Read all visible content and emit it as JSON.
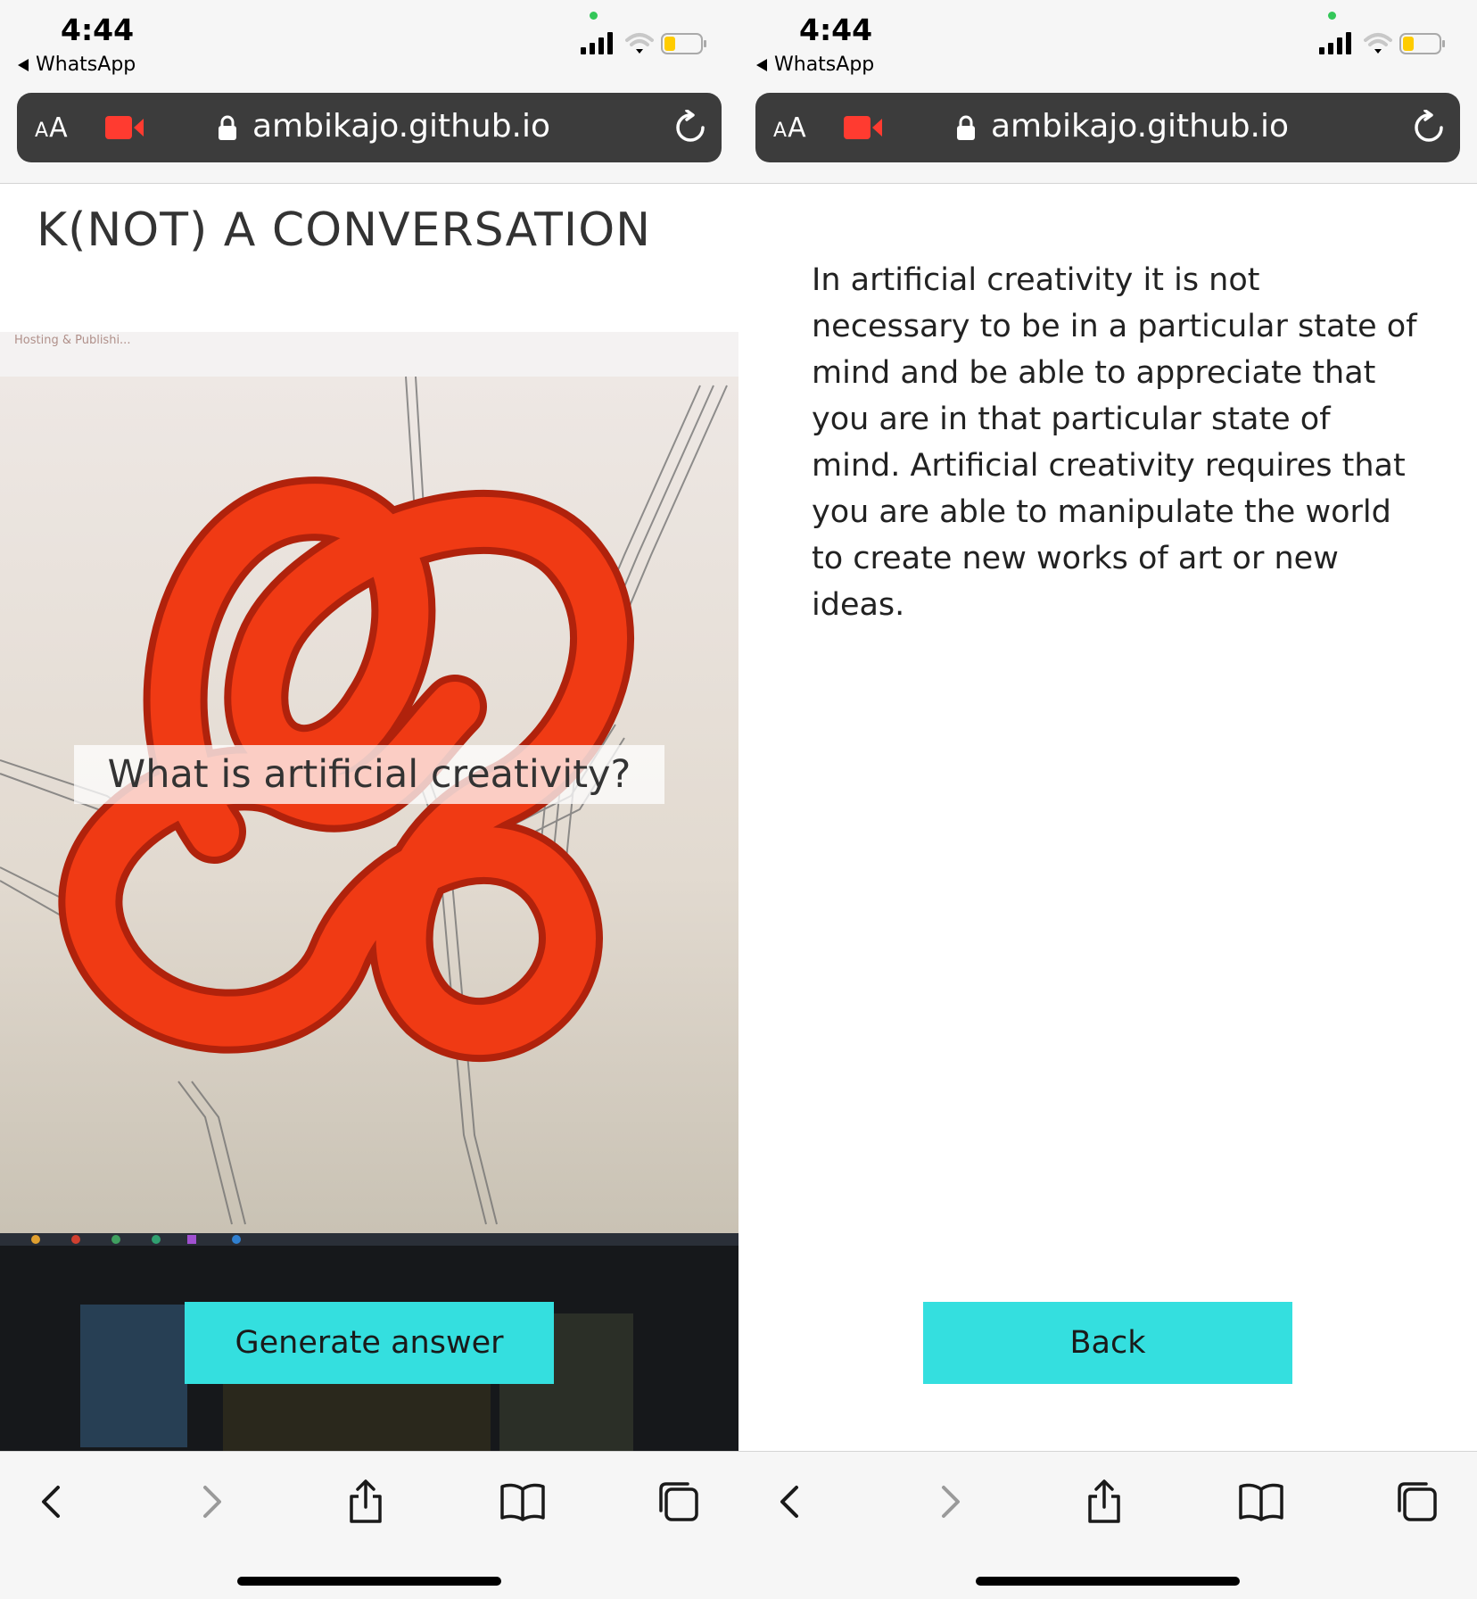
{
  "status": {
    "time": "4:44",
    "back_app": "WhatsApp"
  },
  "browser": {
    "aa_label": "AA",
    "host": "ambikajo.github.io"
  },
  "left": {
    "site_title": "K(NOT) A CONVERSATION",
    "photo_tab_text": "Hosting & Publishi...",
    "question": "What is artificial creativity?",
    "button_label": "Generate answer"
  },
  "right": {
    "answer": "In artificial creativity it is not necessary to be in a particular state of mind and be able to appreciate that you are in that particular state of mind. Artificial creativity requires that you are able to manipulate the world to create new works of art or new ideas.",
    "button_label": "Back"
  },
  "colors": {
    "accent": "#34dfdf",
    "knot": "#f03a14",
    "urlbar": "#3c3c3c",
    "recording": "#ff3b30"
  },
  "toolbar_icons": [
    "back-arrow-icon",
    "forward-arrow-icon",
    "share-icon",
    "bookmarks-icon",
    "tabs-icon"
  ]
}
